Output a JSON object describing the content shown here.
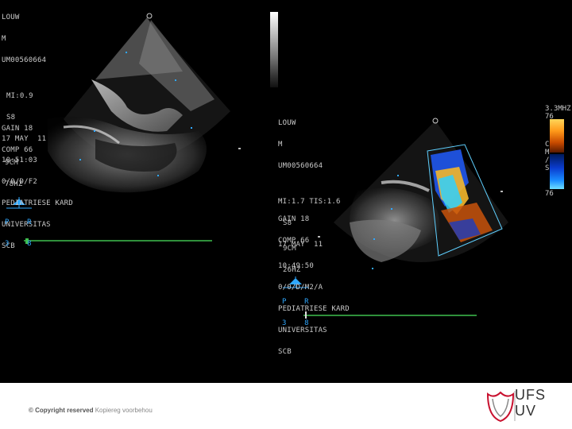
{
  "left_panel": {
    "info_lines": [
      "LOUW",
      "M",
      "UM00560664",
      "",
      "MI:0.9",
      "S8",
      "17 MAY  11",
      "10:51:03",
      "0/0/D/F2",
      "PEDIATRIESE KARD",
      "UNIVERSITAS",
      "SCB"
    ],
    "gain_lines": [
      "GAIN 18",
      "COMP 66"
    ],
    "depth_lines": [
      "9CM",
      "78HZ"
    ],
    "orient_lines": [
      "P    R",
      "3    8"
    ]
  },
  "right_panel": {
    "info_lines": [
      "LOUW",
      "M",
      "UM00560664",
      "",
      "MI:1.7 TIS:1.6",
      "S8",
      "17 MAY  11",
      "10:49:50",
      "0/0/D/M2/A",
      "PEDIATRIESE KARD",
      "UNIVERSITAS",
      "SCB"
    ],
    "gain_lines": [
      "GAIN 18",
      "COMP 66"
    ],
    "depth_lines": [
      "9CM",
      "26HZ"
    ],
    "orient_lines": [
      "P    R",
      "3    8"
    ],
    "color_scale": {
      "top_value": "76",
      "bottom_value": "76",
      "freq": "3.3MHZ",
      "side_letters": [
        "C",
        "M",
        "/",
        "S"
      ]
    }
  },
  "footer": {
    "copyright_bold": "© Copyright reserved",
    "copyright_rest": " Kopiereg voorbehou",
    "logo_top": "UFS",
    "logo_bottom": "UV"
  },
  "colors": {
    "accent_green": "#3fbf4f",
    "logo_red": "#c8102e",
    "text_gray": "#c9c9c9"
  }
}
